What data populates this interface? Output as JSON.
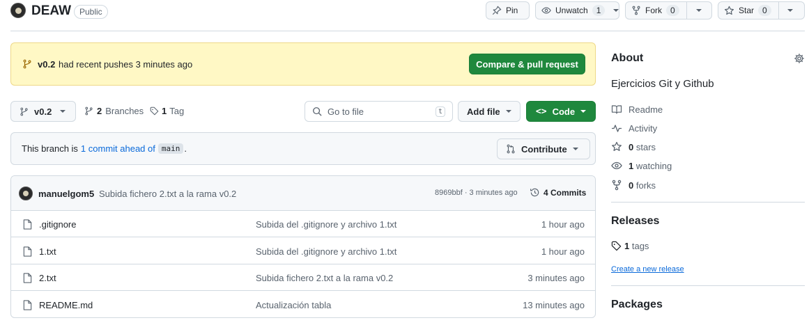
{
  "repo": {
    "name": "DEAW",
    "visibility": "Public"
  },
  "actions": {
    "pin": "Pin",
    "watch": {
      "label": "Unwatch",
      "count": "1"
    },
    "fork": {
      "label": "Fork",
      "count": "0"
    },
    "star": {
      "label": "Star",
      "count": "0"
    }
  },
  "banner": {
    "branch": "v0.2",
    "text": "had recent pushes 3 minutes ago",
    "button": "Compare & pull request"
  },
  "toolbar": {
    "branch": "v0.2",
    "branches_count": "2",
    "branches_label": "Branches",
    "tags_count": "1",
    "tags_label": "Tag",
    "search_placeholder": "Go to file",
    "search_shortcut": "t",
    "add_file": "Add file",
    "code": "Code"
  },
  "ahead": {
    "prefix": "This branch is",
    "link": "1 commit ahead of",
    "base": "main",
    "suffix": ".",
    "contribute": "Contribute"
  },
  "commit": {
    "author": "manuelgom5",
    "message": "Subida fichero 2.txt a la rama v0.2",
    "meta": "8969bbf · 3 minutes ago",
    "commits_label": "4 Commits"
  },
  "files": [
    {
      "name": ".gitignore",
      "message": "Subida del .gitignore y archivo 1.txt",
      "time": "1 hour ago"
    },
    {
      "name": "1.txt",
      "message": "Subida del .gitignore y archivo 1.txt",
      "time": "1 hour ago"
    },
    {
      "name": "2.txt",
      "message": "Subida fichero 2.txt a la rama v0.2",
      "time": "3 minutes ago"
    },
    {
      "name": "README.md",
      "message": "Actualización tabla",
      "time": "13 minutes ago"
    }
  ],
  "about": {
    "title": "About",
    "description": "Ejercicios Git y Github",
    "readme": "Readme",
    "activity": "Activity",
    "stars_count": "0",
    "stars_label": "stars",
    "watching_count": "1",
    "watching_label": "watching",
    "forks_count": "0",
    "forks_label": "forks"
  },
  "releases": {
    "title": "Releases",
    "tags_count": "1",
    "tags_label": "tags",
    "create_link": "Create a new release"
  },
  "packages": {
    "title": "Packages"
  },
  "colors": {
    "accent_green": "#1f883d",
    "link_blue": "#0969da",
    "banner_bg": "#fff8c5"
  }
}
